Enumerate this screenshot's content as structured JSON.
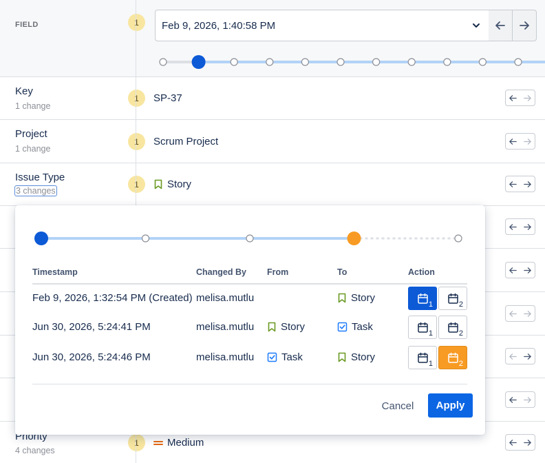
{
  "header": {
    "field_label": "FIELD",
    "badge": "1",
    "timestamp_selected": "Feb 9, 2026, 1:40:58 PM"
  },
  "main_timeline": {
    "points": 11,
    "current_index": 1
  },
  "rows": [
    {
      "name": "Key",
      "changes": "1 change",
      "badge": "1",
      "value": "SP-37",
      "icon": ""
    },
    {
      "name": "Project",
      "changes": "1 change",
      "badge": "1",
      "value": "Scrum Project",
      "icon": ""
    },
    {
      "name": "Issue Type",
      "changes": "3 changes",
      "badge": "1",
      "value": "Story",
      "icon": "story-icon"
    },
    {
      "name": "Priority",
      "changes": "4 changes",
      "badge": "1",
      "value": "Medium",
      "icon": "medium-priority-icon"
    }
  ],
  "popup": {
    "timeline": {
      "points": 5,
      "current_index": 0,
      "selected_index": 3
    },
    "columns": [
      "Timestamp",
      "Changed By",
      "From",
      "To",
      "Action"
    ],
    "changes": [
      {
        "timestamp": "Feb 9, 2026, 1:32:54 PM (Created)",
        "changed_by": "melisa.mutlu",
        "from": "",
        "from_icon": "",
        "to": "Story",
        "to_icon": "story-icon",
        "action_selected": 1
      },
      {
        "timestamp": "Jun 30, 2026, 5:24:41 PM",
        "changed_by": "melisa.mutlu",
        "from": "Story",
        "from_icon": "story-icon",
        "to": "Task",
        "to_icon": "task-icon",
        "action_selected": 0
      },
      {
        "timestamp": "Jun 30, 2026, 5:24:46 PM",
        "changed_by": "melisa.mutlu",
        "from": "Task",
        "from_icon": "task-icon",
        "to": "Story",
        "to_icon": "story-icon",
        "action_selected": 2
      }
    ],
    "action_labels": [
      "1",
      "2"
    ],
    "cancel_label": "Cancel",
    "apply_label": "Apply"
  },
  "colors": {
    "primary": "#0c66e4",
    "selected_blue": "#0c5ad6",
    "selected_orange": "#f89b24",
    "badge_bg": "#f8e6a0",
    "timeline_track": "#b3d3f7",
    "story_green": "#6a9a23",
    "task_blue": "#1d7afc",
    "priority_orange": "#e56910"
  }
}
